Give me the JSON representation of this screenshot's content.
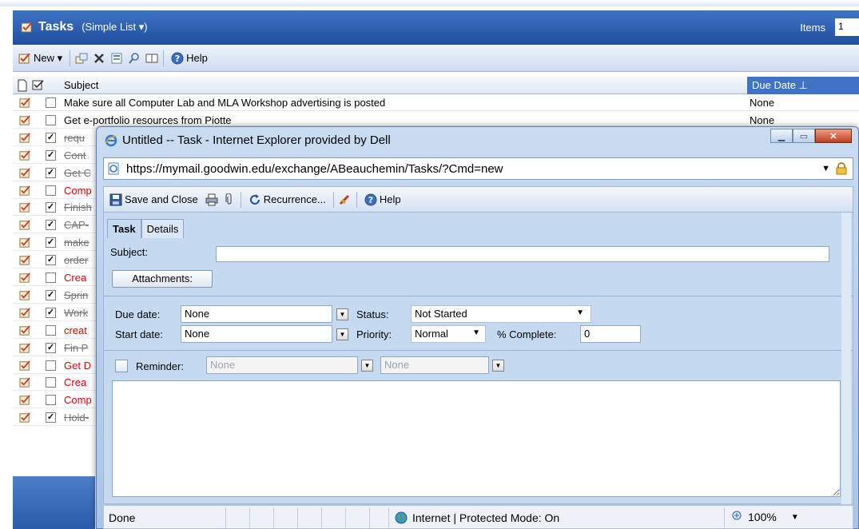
{
  "owa": {
    "title": "Tasks",
    "view_label": "(Simple List ▾)",
    "items_label": "Items",
    "items_value": "1",
    "toolbar": {
      "new_label": "New ▾",
      "help_label": "Help"
    },
    "columns": {
      "subject": "Subject",
      "due_date": "Due Date ⊥"
    },
    "tasks": [
      {
        "subject": "Make sure all Computer Lab and MLA Workshop advertising is posted",
        "due": "None",
        "checked": false,
        "style": "normal"
      },
      {
        "subject": "Get e-portfolio resources from Piotte",
        "due": "None",
        "checked": false,
        "style": "normal"
      },
      {
        "subject": "requ",
        "due": "",
        "checked": true,
        "style": "done"
      },
      {
        "subject": "Cont",
        "due": "",
        "checked": true,
        "style": "done"
      },
      {
        "subject": "Get C",
        "due": "",
        "checked": true,
        "style": "done"
      },
      {
        "subject": "Comp",
        "due": "",
        "checked": false,
        "style": "red"
      },
      {
        "subject": "Finish",
        "due": "",
        "checked": true,
        "style": "done"
      },
      {
        "subject": "CAP-",
        "due": "",
        "checked": true,
        "style": "done"
      },
      {
        "subject": "make",
        "due": "",
        "checked": true,
        "style": "done"
      },
      {
        "subject": "order",
        "due": "",
        "checked": true,
        "style": "done"
      },
      {
        "subject": "Crea",
        "due": "",
        "checked": false,
        "style": "red"
      },
      {
        "subject": "Sprin",
        "due": "",
        "checked": true,
        "style": "done"
      },
      {
        "subject": "Work",
        "due": "",
        "checked": true,
        "style": "done"
      },
      {
        "subject": "creat",
        "due": "",
        "checked": false,
        "style": "red"
      },
      {
        "subject": "Fin P",
        "due": "",
        "checked": true,
        "style": "done"
      },
      {
        "subject": "Get D",
        "due": "",
        "checked": false,
        "style": "red"
      },
      {
        "subject": "Crea",
        "due": "",
        "checked": false,
        "style": "red"
      },
      {
        "subject": "Comp",
        "due": "",
        "checked": false,
        "style": "red"
      },
      {
        "subject": "Hold-",
        "due": "",
        "checked": true,
        "style": "done"
      }
    ]
  },
  "popup": {
    "window_title": "Untitled -- Task - Internet Explorer provided by Dell",
    "url": "https://mymail.goodwin.edu/exchange/ABeauchemin/Tasks/?Cmd=new",
    "toolbar": {
      "save_close": "Save and Close",
      "recurrence": "Recurrence...",
      "help": "Help"
    },
    "tabs": [
      "Task",
      "Details"
    ],
    "form": {
      "subject_label": "Subject:",
      "subject_value": "",
      "attachments_label": "Attachments:",
      "due_date_label": "Due date:",
      "due_date_value": "None",
      "status_label": "Status:",
      "status_value": "Not Started",
      "start_date_label": "Start date:",
      "start_date_value": "None",
      "priority_label": "Priority:",
      "priority_value": "Normal",
      "complete_label": "% Complete:",
      "complete_value": "0",
      "reminder_label": "Reminder:",
      "reminder_date": "None",
      "reminder_time": "None"
    },
    "status": {
      "done": "Done",
      "zone": "Internet | Protected Mode: On",
      "zoom": "100%"
    }
  },
  "colors": {
    "header_blue": "#2d62b3",
    "task_red": "#e00000",
    "popup_frame": "#bcd3ee"
  }
}
